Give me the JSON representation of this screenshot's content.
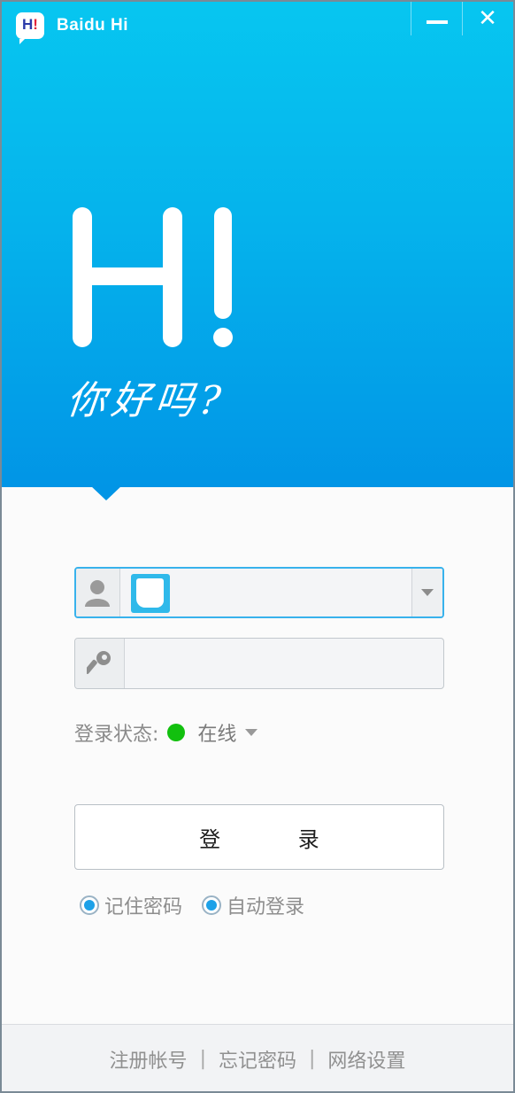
{
  "window": {
    "title": "Baidu Hi",
    "logo_text": "H",
    "logo_excl": "!",
    "minimize_icon": "minimize-icon",
    "close_label": "✕"
  },
  "hero": {
    "greeting": "你好吗?"
  },
  "form": {
    "account": {
      "value": "",
      "placeholder": ""
    },
    "password": {
      "value": "",
      "placeholder": ""
    },
    "status": {
      "label": "登录状态:",
      "value": "在线",
      "color": "#12c00e"
    },
    "login_label": "登 录",
    "options": [
      {
        "label": "记住密码",
        "checked": true
      },
      {
        "label": "自动登录",
        "checked": true
      }
    ]
  },
  "footer": {
    "links": [
      "注册帐号",
      "忘记密码",
      "网络设置"
    ],
    "separator": "|"
  },
  "colors": {
    "hero_top": "#07c6f0",
    "hero_bottom": "#0195e6",
    "accent": "#1da1e8"
  }
}
